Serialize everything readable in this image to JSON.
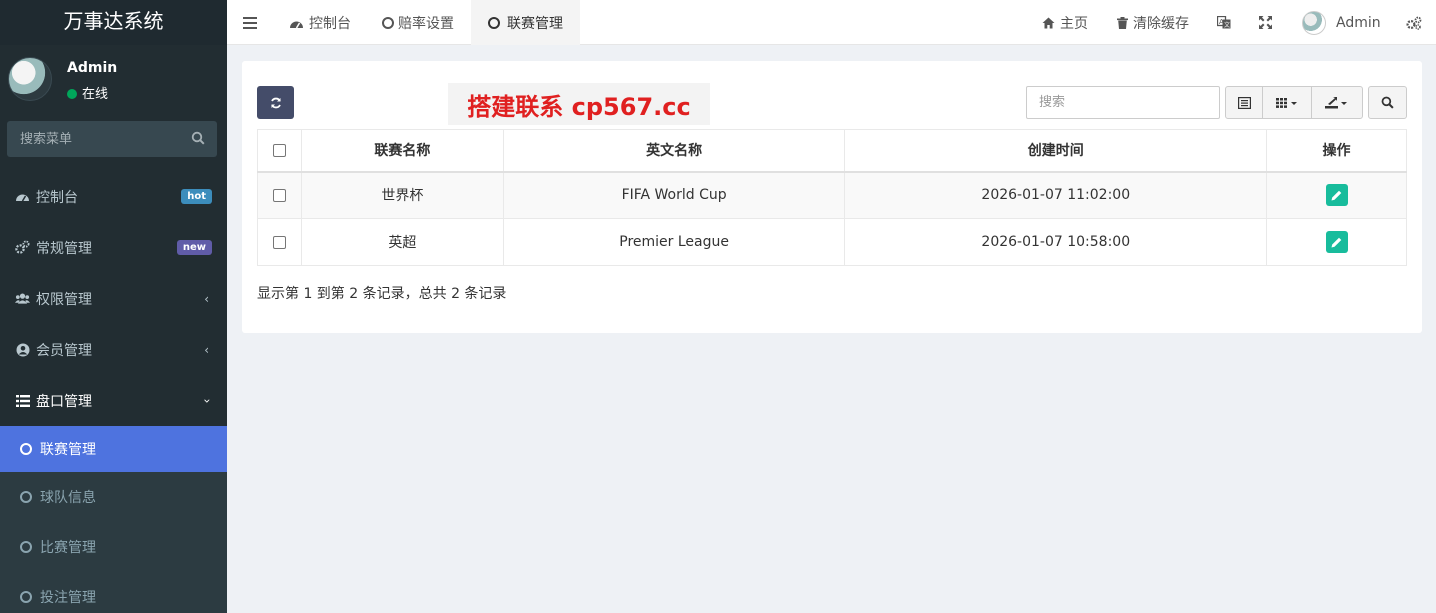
{
  "app": {
    "title": "万事达系统"
  },
  "user": {
    "name": "Admin",
    "status": "在线"
  },
  "sidebar": {
    "search_placeholder": "搜索菜单",
    "items": [
      {
        "label": "控制台",
        "icon": "dashboard-icon",
        "badge": "hot"
      },
      {
        "label": "常规管理",
        "icon": "cogs-icon",
        "badge": "new"
      },
      {
        "label": "权限管理",
        "icon": "group-icon"
      },
      {
        "label": "会员管理",
        "icon": "user-circle-icon"
      },
      {
        "label": "盘口管理",
        "icon": "list-icon"
      }
    ],
    "sub_items": [
      {
        "label": "联赛管理",
        "active": true
      },
      {
        "label": "球队信息"
      },
      {
        "label": "比赛管理"
      },
      {
        "label": "投注管理"
      }
    ]
  },
  "topbar": {
    "tabs": [
      {
        "label": "控制台"
      },
      {
        "label": "赔率设置"
      },
      {
        "label": "联赛管理"
      }
    ],
    "home": "主页",
    "clear_cache": "清除缓存",
    "admin": "Admin"
  },
  "toolbar": {
    "promo": "搭建联系 cp567.cc",
    "search_placeholder": "搜索"
  },
  "table": {
    "headers": [
      "联赛名称",
      "英文名称",
      "创建时间",
      "操作"
    ],
    "rows": [
      {
        "name": "世界杯",
        "english": "FIFA World Cup",
        "created": "2026-01-07 11:02:00"
      },
      {
        "name": "英超",
        "english": "Premier League",
        "created": "2026-01-07 10:58:00"
      }
    ],
    "summary": "显示第 1 到第 2 条记录，总共 2 条记录"
  },
  "colors": {
    "sidebar_bg": "#222d32",
    "active_sub": "#4e73df",
    "badge_hot": "#3c8dbc",
    "badge_new": "#605ca8",
    "edit_btn": "#18bc9c",
    "promo_text": "#e02020"
  }
}
